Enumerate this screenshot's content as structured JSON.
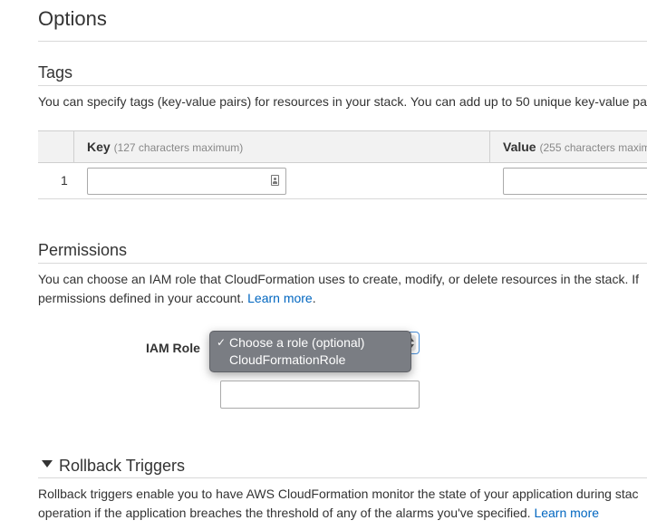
{
  "options": {
    "title": "Options"
  },
  "tags": {
    "title": "Tags",
    "description": "You can specify tags (key-value pairs) for resources in your stack. You can add up to 50 unique key-value pa",
    "table": {
      "key_header": "Key",
      "key_hint": "(127 characters maximum)",
      "value_header": "Value",
      "value_hint": "(255 characters maxim",
      "rows": [
        {
          "number": "1",
          "key": "",
          "value": ""
        }
      ]
    }
  },
  "permissions": {
    "title": "Permissions",
    "description_line1": "You can choose an IAM role that CloudFormation uses to create, modify, or delete resources in the stack. If",
    "description_line2": "permissions defined in your account.",
    "learn_more": "Learn more",
    "period": ".",
    "iam_role_label": "IAM Role",
    "dropdown": {
      "selected_mark": "✓",
      "options": [
        "Choose a role (optional)",
        "CloudFormationRole"
      ]
    },
    "role_arn_value": ""
  },
  "rollback": {
    "title": "Rollback Triggers",
    "description_line1": "Rollback triggers enable you to have AWS CloudFormation monitor the state of your application during stac",
    "description_line2": "operation if the application breaches the threshold of any of the alarms you've specified.",
    "learn_more": "Learn more"
  },
  "colors": {
    "link": "#0066c0",
    "dropdown_bg": "#7a7d83",
    "focus": "#4a90d9"
  }
}
